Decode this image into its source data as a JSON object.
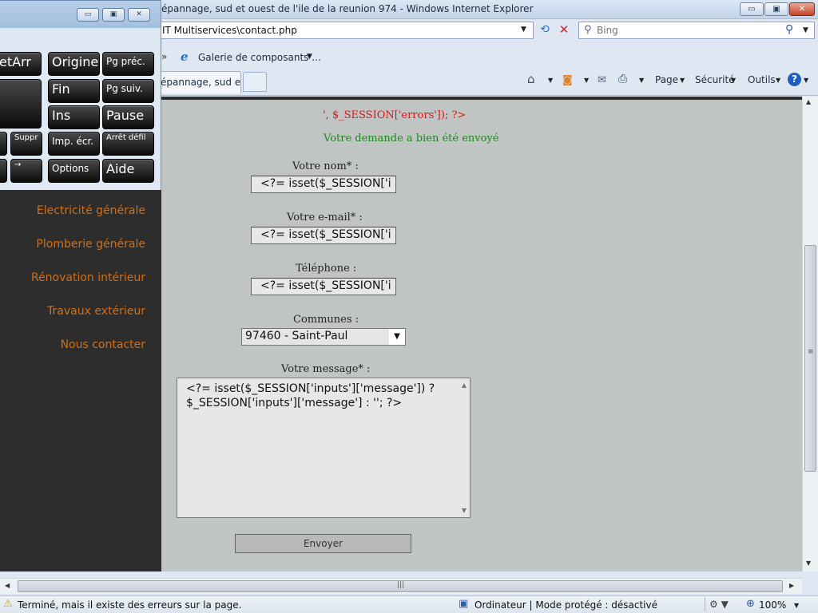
{
  "window": {
    "title": "épannage, sud et ouest de l'ile de la reunion 974 - Windows Internet Explorer",
    "min_label": "▭",
    "max_label": "▣",
    "close_label": "✕"
  },
  "address": {
    "url": "IT Multiservices\\contact.php"
  },
  "search": {
    "placeholder": "Bing"
  },
  "favorites": {
    "gallery_label": "Galerie de composants ..."
  },
  "tabs": {
    "active_label": "épannage, sud e..."
  },
  "commands": {
    "page": "Page",
    "security": "Sécurité",
    "tools": "Outils",
    "help": "?"
  },
  "sidebar": {
    "items": [
      {
        "label": "Electricité générale"
      },
      {
        "label": "Plomberie générale"
      },
      {
        "label": "Rénovation intérieur"
      },
      {
        "label": "Travaux extérieur"
      },
      {
        "label": "Nous contacter"
      }
    ]
  },
  "form": {
    "errors_text": "', $_SESSION['errors']); ?>",
    "success_text": "Votre demande a bien été envoyé",
    "name_label": "Votre nom* :",
    "name_value": "<?= isset($_SESSION['i",
    "email_label": "Votre e-mail* :",
    "email_value": "<?= isset($_SESSION['i",
    "phone_label": "Téléphone :",
    "phone_value": "<?= isset($_SESSION['i",
    "commune_label": "Communes :",
    "commune_value": "97460 - Saint-Paul",
    "message_label": "Votre message* :",
    "message_value": "<?= isset($_SESSION['inputs']['message']) ? $_SESSION['inputs']['message'] : ''; ?>",
    "submit_label": "Envoyer"
  },
  "status": {
    "text": "Terminé, mais il existe des erreurs sur la page.",
    "zone": "Ordinateur | Mode protégé : désactivé",
    "zoom": "100%"
  },
  "osk": {
    "keys": [
      {
        "label": "etArr"
      },
      {
        "label": "Origine"
      },
      {
        "label": "Pg préc."
      },
      {
        "label": "Fin"
      },
      {
        "label": "Pg suiv."
      },
      {
        "label": "Ins"
      },
      {
        "label": "Pause"
      },
      {
        "label": "Suppr"
      },
      {
        "label": "Imp. écr."
      },
      {
        "label": "Arrêt défil"
      },
      {
        "label": "→"
      },
      {
        "label": "Options"
      },
      {
        "label": "Aide"
      }
    ]
  },
  "icons": {
    "refresh": "refresh-icon",
    "stop": "stop-icon",
    "home": "home-icon",
    "feeds": "feeds-icon",
    "print": "print-icon",
    "warning": "warning-icon",
    "zoom": "zoom-icon"
  },
  "colors": {
    "nav_link": "#d16f16",
    "error": "#d11a1a",
    "success": "#1f8a1f",
    "sidebar_bg": "#2d2d2d",
    "content_bg": "#c0c4c2"
  }
}
